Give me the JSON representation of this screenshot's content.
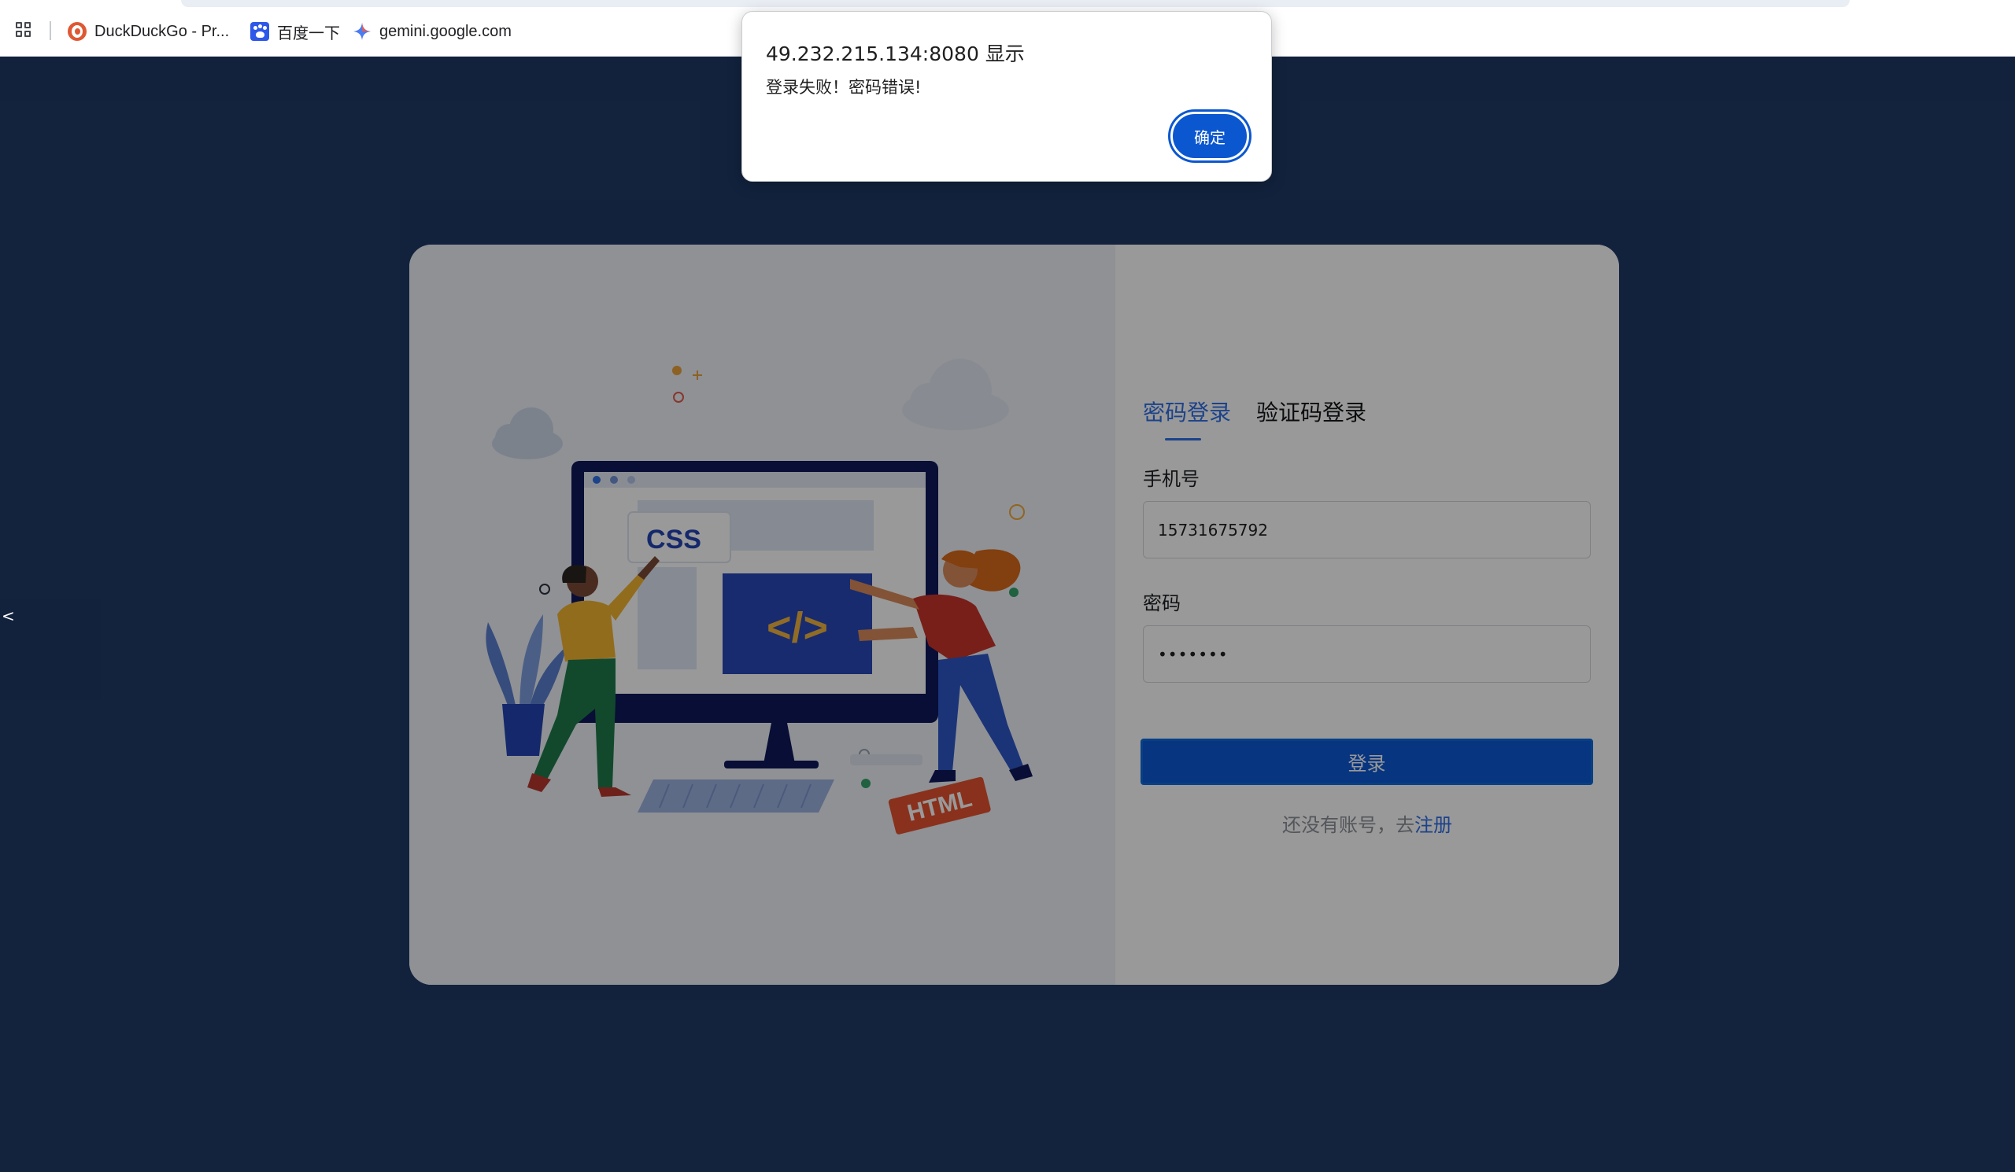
{
  "bookmarks": [
    {
      "label": "DuckDuckGo - Pr...",
      "icon": "duckduckgo-icon"
    },
    {
      "label": "百度一下",
      "icon": "baidu-paw-icon"
    },
    {
      "label": "gemini.google.com",
      "icon": "gemini-sparkle-icon"
    }
  ],
  "illustration": {
    "css_label": "CSS",
    "code_label": "</>",
    "html_label": "HTML"
  },
  "login": {
    "tabs": [
      {
        "label": "密码登录",
        "active": true
      },
      {
        "label": "验证码登录",
        "active": false
      }
    ],
    "phone_label": "手机号",
    "phone_value": "15731675792",
    "password_label": "密码",
    "password_value": "•••••••",
    "submit_label": "登录",
    "register_prompt": "还没有账号，去",
    "register_link": "注册"
  },
  "alert": {
    "title": "49.232.215.134:8080 显示",
    "message": "登录失败！密码错误!",
    "ok_label": "确定"
  },
  "side_nav": {
    "back_glyph": "<"
  },
  "colors": {
    "page_background": "#1f3966",
    "accent": "#2f6ee6",
    "button": "#0c59d6",
    "dialog_button": "#0b57d0"
  }
}
